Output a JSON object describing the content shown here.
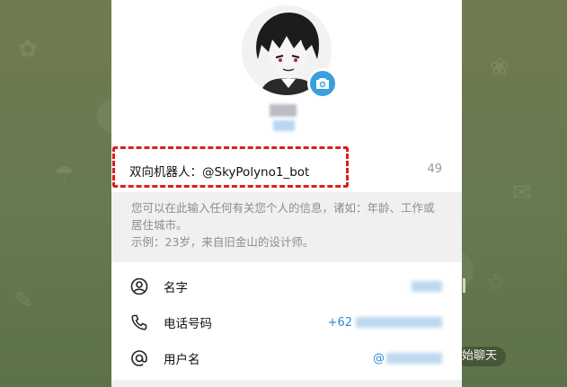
{
  "profile": {
    "name_obscured": "",
    "avatar_alt": "avatar",
    "bio_text": "双向机器人：@SkyPolyno1_bot",
    "bio_char_count": "49",
    "hint_line1": "您可以在此输入任何有关您个人的信息，诸如：年龄、工作或居住城市。",
    "hint_line2": "示例：23岁，来自旧金山的设计师。"
  },
  "info_rows": [
    {
      "label": "名字",
      "value": "",
      "icon": "person-icon"
    },
    {
      "label": "电话号码",
      "value": "+62",
      "icon": "phone-icon"
    },
    {
      "label": "用户名",
      "value": "@",
      "icon": "at-icon"
    }
  ],
  "background": {
    "start_chat_label": "始聊天"
  },
  "colors": {
    "accent": "#3a9fdf",
    "link": "#2e8ccf",
    "highlight": "#e01b1b",
    "hint_bg": "#f0f0f0"
  }
}
